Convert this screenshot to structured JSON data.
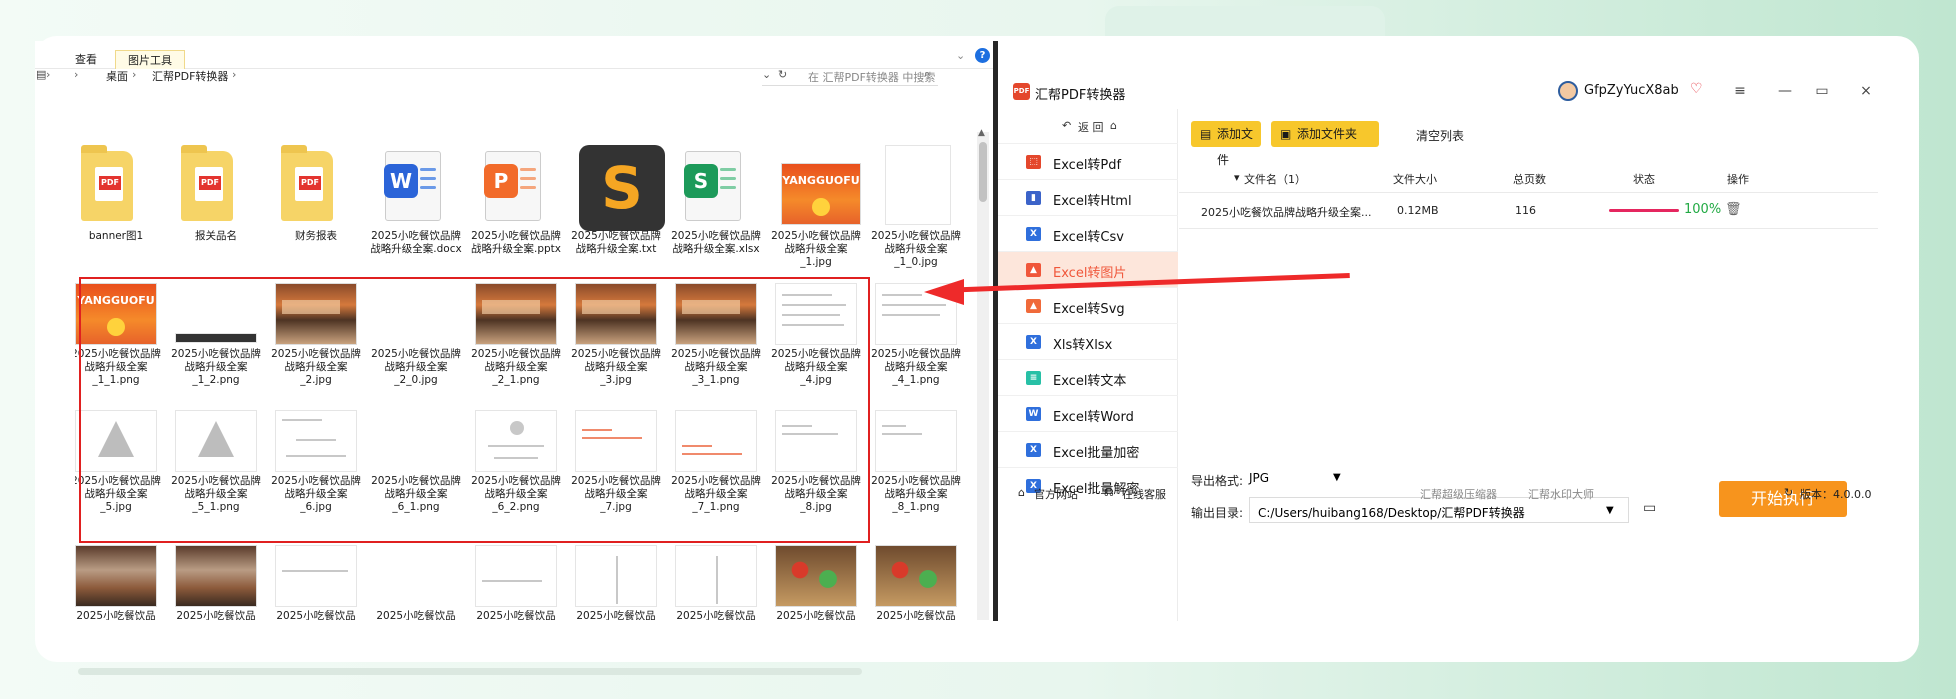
{
  "explorer": {
    "ribbon": {
      "tab_view": "查看",
      "tab_picture_tools": "图片工具"
    },
    "address": {
      "part1": "桌面",
      "part2": "汇帮PDF转换器"
    },
    "search_placeholder": "在 汇帮PDF转换器 中搜索",
    "files_row1": [
      {
        "name": "banner图1"
      },
      {
        "name": "报关品名"
      },
      {
        "name": "财务报表"
      },
      {
        "name": "2025小吃餐饮品牌战略升级全案.docx"
      },
      {
        "name": "2025小吃餐饮品牌战略升级全案.pptx"
      },
      {
        "name": "2025小吃餐饮品牌战略升级全案.txt"
      },
      {
        "name": "2025小吃餐饮品牌战略升级全案.xlsx"
      },
      {
        "name": "2025小吃餐饮品牌战略升级全案_1.jpg"
      },
      {
        "name": "2025小吃餐饮品牌战略升级全案_1_0.jpg"
      }
    ],
    "files_row2": [
      {
        "name": "2025小吃餐饮品牌战略升级全案_1_1.png"
      },
      {
        "name": "2025小吃餐饮品牌战略升级全案_1_2.png"
      },
      {
        "name": "2025小吃餐饮品牌战略升级全案_2.jpg"
      },
      {
        "name": "2025小吃餐饮品牌战略升级全案_2_0.jpg"
      },
      {
        "name": "2025小吃餐饮品牌战略升级全案_2_1.png"
      },
      {
        "name": "2025小吃餐饮品牌战略升级全案_3.jpg"
      },
      {
        "name": "2025小吃餐饮品牌战略升级全案_3_1.png"
      },
      {
        "name": "2025小吃餐饮品牌战略升级全案_4.jpg"
      },
      {
        "name": "2025小吃餐饮品牌战略升级全案_4_1.png"
      }
    ],
    "files_row3": [
      {
        "name": "2025小吃餐饮品牌战略升级全案_5.jpg"
      },
      {
        "name": "2025小吃餐饮品牌战略升级全案_5_1.png"
      },
      {
        "name": "2025小吃餐饮品牌战略升级全案_6.jpg"
      },
      {
        "name": "2025小吃餐饮品牌战略升级全案_6_1.png"
      },
      {
        "name": "2025小吃餐饮品牌战略升级全案_6_2.png"
      },
      {
        "name": "2025小吃餐饮品牌战略升级全案_7.jpg"
      },
      {
        "name": "2025小吃餐饮品牌战略升级全案_7_1.png"
      },
      {
        "name": "2025小吃餐饮品牌战略升级全案_8.jpg"
      },
      {
        "name": "2025小吃餐饮品牌战略升级全案_8_1.png"
      }
    ],
    "row4_label": "2025小吃餐饮品",
    "thumb_brand": "YANGGUOFU"
  },
  "app": {
    "title": "汇帮PDF转换器",
    "username": "GfpZyYucX8ab",
    "back_label": "返 回",
    "sidebar": [
      {
        "label": "Excel转Pdf",
        "color": "#e4472c",
        "icon": "pdf-icon"
      },
      {
        "label": "Excel转Html",
        "color": "#3b63c9",
        "icon": "html-icon"
      },
      {
        "label": "Excel转Csv",
        "color": "#2f6fdc",
        "icon": "csv-icon"
      },
      {
        "label": "Excel转图片",
        "color": "#f0563a",
        "icon": "image-icon"
      },
      {
        "label": "Excel转Svg",
        "color": "#f06a3a",
        "icon": "svg-icon"
      },
      {
        "label": "Xls转Xlsx",
        "color": "#2f6fdc",
        "icon": "xlsx-icon"
      },
      {
        "label": "Excel转文本",
        "color": "#27c0a6",
        "icon": "text-icon"
      },
      {
        "label": "Excel转Word",
        "color": "#2f6fdc",
        "icon": "word-icon"
      },
      {
        "label": "Excel批量加密",
        "color": "#2f6fdc",
        "icon": "encrypt-icon"
      },
      {
        "label": "Excel批量解密",
        "color": "#2f6fdc",
        "icon": "decrypt-icon"
      }
    ],
    "add_file": "添加文件",
    "add_folder": "添加文件夹",
    "clear_list": "清空列表",
    "table": {
      "headers": {
        "name": "文件名（1）",
        "size": "文件大小",
        "pages": "总页数",
        "status": "状态",
        "ops": "操作"
      },
      "row": {
        "name": "2025小吃餐饮品牌战略升级全案...",
        "size": "0.12MB",
        "pages": "116",
        "percent": "100%",
        "progress": 1.0
      }
    },
    "export_format_label": "导出格式:",
    "export_format_value": "JPG",
    "output_dir_label": "输出目录:",
    "output_dir_value": "C:/Users/huibang168/Desktop/汇帮PDF转换器",
    "start_button": "开始执行",
    "footer": {
      "website": "官方网站",
      "support": "在线客服",
      "compressor": "汇帮超级压缩器",
      "watermark": "汇帮水印大师",
      "version": "版本：4.0.0.0"
    }
  }
}
